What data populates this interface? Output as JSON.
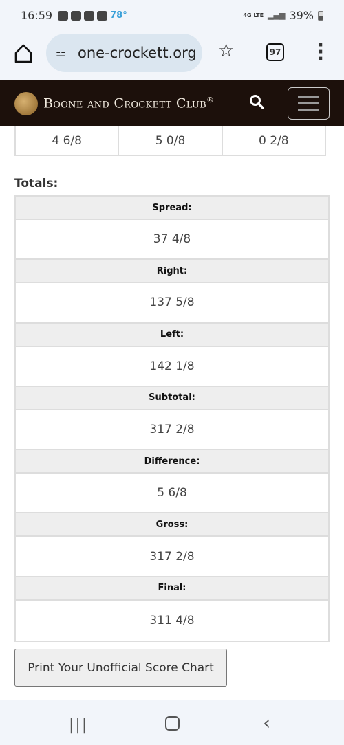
{
  "status_bar": {
    "time": "16:59",
    "temperature": "78°",
    "network": "4G LTE",
    "battery": "39%"
  },
  "browser": {
    "url": "one-crockett.org",
    "tab_count": "97"
  },
  "site": {
    "brand": "Boone and Crockett Club",
    "registered": "®"
  },
  "top_row": [
    "4 6/8",
    "5 0/8",
    "0 2/8"
  ],
  "totals": {
    "label": "Totals:",
    "rows": [
      {
        "label": "Spread:",
        "value": "37 4/8"
      },
      {
        "label": "Right:",
        "value": "137 5/8"
      },
      {
        "label": "Left:",
        "value": "142 1/8"
      },
      {
        "label": "Subtotal:",
        "value": "317 2/8"
      },
      {
        "label": "Difference:",
        "value": "5 6/8"
      },
      {
        "label": "Gross:",
        "value": "317 2/8"
      },
      {
        "label": "Final:",
        "value": "311 4/8"
      }
    ]
  },
  "print_button": "Print Your Unofficial Score Chart",
  "colors": {
    "header_bg": "#1c100b",
    "table_header_bg": "#eeeeee",
    "border": "#dddddd",
    "temperature": "#3aa0d8"
  }
}
